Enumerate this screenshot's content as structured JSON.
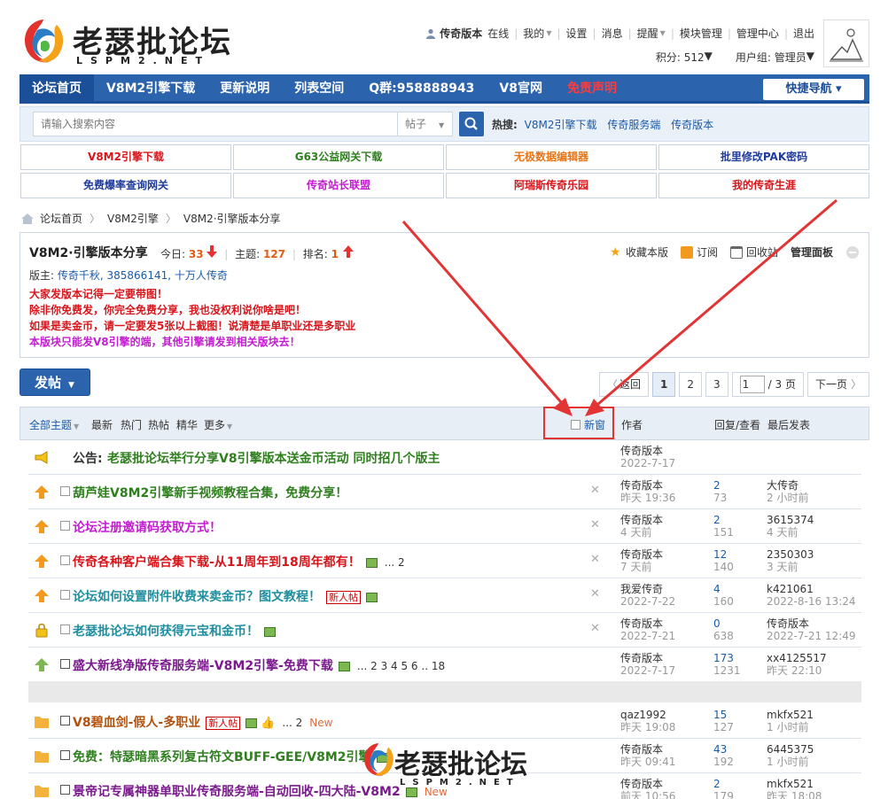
{
  "logo": {
    "cn": "老瑟批论坛",
    "en": "LSPM2.NET"
  },
  "user": {
    "name": "传奇版本",
    "status": "在线",
    "links": [
      "我的",
      "设置",
      "消息",
      "提醒",
      "模块管理",
      "管理中心",
      "退出"
    ],
    "points_label": "积分: 512",
    "group_label": "用户组: 管理员"
  },
  "nav": {
    "items": [
      "论坛首页",
      "V8M2引擎下载",
      "更新说明",
      "列表空间",
      "Q群:958888943",
      "V8官网",
      "免责声明"
    ],
    "quick": "快捷导航 ▾"
  },
  "search": {
    "placeholder": "请输入搜索内容",
    "type": "帖子",
    "hot_label": "热搜:",
    "hot": [
      "V8M2引擎下载",
      "传奇服务端",
      "传奇版本"
    ]
  },
  "links_grid": [
    {
      "label": "V8M2引擎下载",
      "color": "#d7151b"
    },
    {
      "label": "G63公益网关下载",
      "color": "#2f7f1f"
    },
    {
      "label": "无极数据编辑器",
      "color": "#e67517"
    },
    {
      "label": "批里修改PAK密码",
      "color": "#1f3c9c"
    },
    {
      "label": "免费爆率查询网关",
      "color": "#1f3c9c"
    },
    {
      "label": "传奇站长联盟",
      "color": "#c21dd0"
    },
    {
      "label": "阿瑞斯传奇乐园",
      "color": "#d7151b"
    },
    {
      "label": "我的传奇生涯",
      "color": "#d7151b"
    }
  ],
  "breadcrumb": [
    "论坛首页",
    "V8M2引擎",
    "V8M2·引擎版本分享"
  ],
  "forum": {
    "title": "V8M2·引擎版本分享",
    "today_label": "今日:",
    "today": "33",
    "topics_label": "主题:",
    "topics": "127",
    "rank_label": "排名:",
    "rank": "1",
    "mod_label": "版主:",
    "mods": "传奇千秋, 385866141, 十万人传奇",
    "notes": [
      {
        "text": "大家发版本记得一定要带图！",
        "color": "#d7151b"
      },
      {
        "text": "除非你免费发，你完全免费分享，我也没权利说你啥是吧！",
        "color": "#d7151b"
      },
      {
        "text": "如果是卖金币，请一定要发5张以上截图！说清楚是单职业还是多职业",
        "color": "#d7151b"
      },
      {
        "text": "本版块只能发V8引擎的端，其他引擎请发到相关版块去！",
        "color": "#c21dd0"
      }
    ],
    "actions": [
      "收藏本版",
      "订阅",
      "回收站",
      "管理面板"
    ]
  },
  "post_button": "发帖",
  "pager": {
    "back": "返回",
    "pages": [
      "1",
      "2",
      "3"
    ],
    "input": "1",
    "total": "/ 3 页",
    "next": "下一页"
  },
  "table_header": {
    "tabs": [
      "全部主题",
      "最新",
      "热门",
      "热帖",
      "精华",
      "更多"
    ],
    "new_window": "新窗",
    "author": "作者",
    "replies": "回复/查看",
    "last": "最后发表"
  },
  "announcement": {
    "prefix": "公告:",
    "title": "老瑟批论坛举行分享V8引擎版本送金币活动 同时招几个版主",
    "author": "传奇版本",
    "date": "2022-7-17"
  },
  "threads": [
    {
      "title": "葫芦娃V8M2引擎新手视频教程合集，免费分享！",
      "color": "#2f7f1f",
      "author": "传奇版本",
      "date": "昨天 19:36",
      "replies": "2",
      "views": "73",
      "last_user": "大传奇",
      "last_time": "2 小时前",
      "extra": ""
    },
    {
      "title": "论坛注册邀请码获取方式！",
      "color": "#c21dd0",
      "author": "传奇版本",
      "date": "4 天前",
      "replies": "2",
      "views": "151",
      "last_user": "3615374",
      "last_time": "4 天前",
      "extra": ""
    },
    {
      "title": "传奇各种客户端合集下载-从11周年到18周年都有！",
      "color": "#d7151b",
      "author": "传奇版本",
      "date": "7 天前",
      "replies": "12",
      "views": "140",
      "last_user": "2350303",
      "last_time": "3 天前",
      "extra": "... 2"
    },
    {
      "title": "论坛如何设置附件收费来卖金币？图文教程！",
      "color": "#1f8fa0",
      "author": "我爱传奇",
      "date": "2022-7-22",
      "replies": "4",
      "views": "160",
      "last_user": "k421061",
      "last_time": "2022-8-16 13:24",
      "extra": "新人帖"
    },
    {
      "title": "老瑟批论坛如何获得元宝和金币！",
      "color": "#1f8fa0",
      "author": "传奇版本",
      "date": "2022-7-21",
      "replies": "0",
      "views": "638",
      "last_user": "传奇版本",
      "last_time": "2022-7-21 12:49",
      "extra": ""
    },
    {
      "title": "盛大新线净版传奇服务端-V8M2引擎-免费下载",
      "color": "#7a1a8c",
      "author": "传奇版本",
      "date": "2022-7-17",
      "replies": "173",
      "views": "1231",
      "last_user": "xx4125517",
      "last_time": "昨天 22:10",
      "extra": "... 2 3 4 5 6 .. 18"
    }
  ],
  "normal_threads": [
    {
      "title": "V8碧血剑-假人-多职业",
      "color": "#b1520f",
      "author": "qaz1992",
      "date": "昨天 19:08",
      "replies": "15",
      "views": "127",
      "last_user": "mkfx521",
      "last_time": "1 小时前",
      "badge": "新人帖",
      "pages": "... 2",
      "new": "New"
    },
    {
      "title": "免费：特瑟暗黑系列复古符文BUFF-GEE/V8M2引擎",
      "color": "#2f7f1f",
      "author": "传奇版本",
      "date": "昨天 09:41",
      "replies": "43",
      "views": "192",
      "last_user": "6445375",
      "last_time": "1 小时前",
      "badge": "",
      "pages": "",
      "new": ""
    },
    {
      "title": "景帝记专属神器单职业传奇服务端-自动回收-四大陆-V8M2",
      "color": "#7a1a8c",
      "author": "传奇版本",
      "date": "前天 10:56",
      "replies": "2",
      "views": "179",
      "last_user": "mkfx521",
      "last_time": "昨天 18:08",
      "badge": "",
      "pages": "",
      "new": "New"
    }
  ],
  "colors": {
    "nav": "#2b63ac",
    "accent_red": "#e23434"
  }
}
